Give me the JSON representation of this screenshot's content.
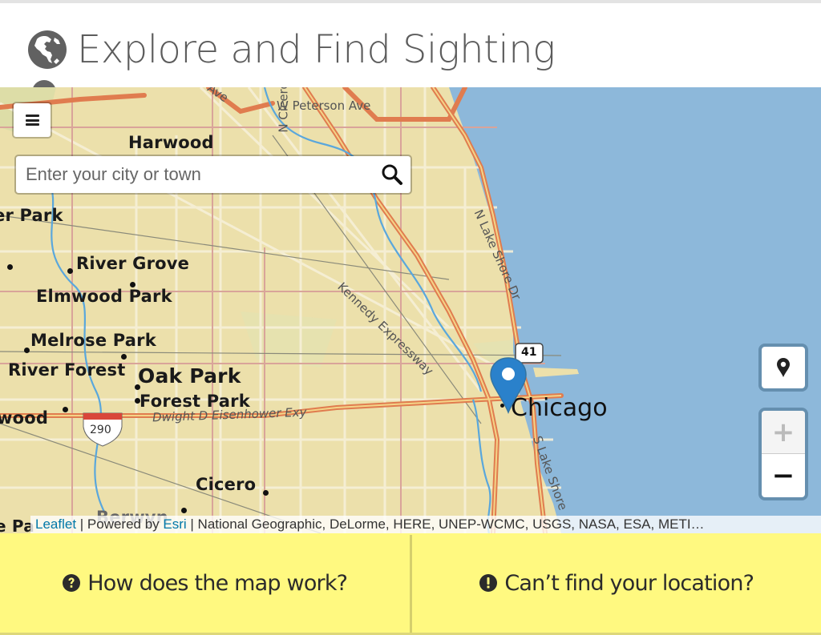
{
  "header": {
    "title": "Explore and Find Sighting",
    "icon": "globe-americas-icon"
  },
  "map": {
    "search": {
      "placeholder": "Enter your city or town",
      "value": "",
      "icon": "search-icon"
    },
    "controls": {
      "menu_icon": "menu-icon",
      "locate_icon": "map-marker-icon",
      "zoom_in_label": "+",
      "zoom_out_label": "−",
      "zoom_in_disabled": true
    },
    "marker": {
      "icon": "map-pin-icon",
      "color": "#2a81cb"
    },
    "labels": {
      "harwood": "Harwood",
      "peterson": "W Peterson Ave",
      "ncicero": "N Cicero",
      "ave_top": "Ave",
      "park_left": "er Park",
      "river_grove": "River Grove",
      "elmwood_park": "Elmwood Park",
      "melrose_park": "Melrose Park",
      "river_forest": "River Forest",
      "oak_park": "Oak Park",
      "forest_park": "Forest Park",
      "wood_left": "wood",
      "eisenhower": "Dwight D Eisenhower Exy",
      "i290": "290",
      "us41": "41",
      "cicero": "Cicero",
      "berwyn": "Berwyn",
      "chicago": "Chicago",
      "kennedy": "Kennedy Expressway",
      "lake_shore_n": "N Lake Shore Dr",
      "lake_shore_s": "S Lake Shore",
      "pa_left": "e Pa"
    },
    "attribution": {
      "leaflet": "Leaflet",
      "sep1": " | Powered by ",
      "esri": "Esri",
      "rest": " | National Geographic, DeLorme, HERE, UNEP-WCMC, USGS, NASA, ESA, METI…"
    }
  },
  "footer": {
    "help": {
      "label": "How does the map work?",
      "icon": "question-circle-icon"
    },
    "location": {
      "label": "Can’t find your location?",
      "icon": "exclamation-circle-icon"
    },
    "background": "#fff980"
  }
}
